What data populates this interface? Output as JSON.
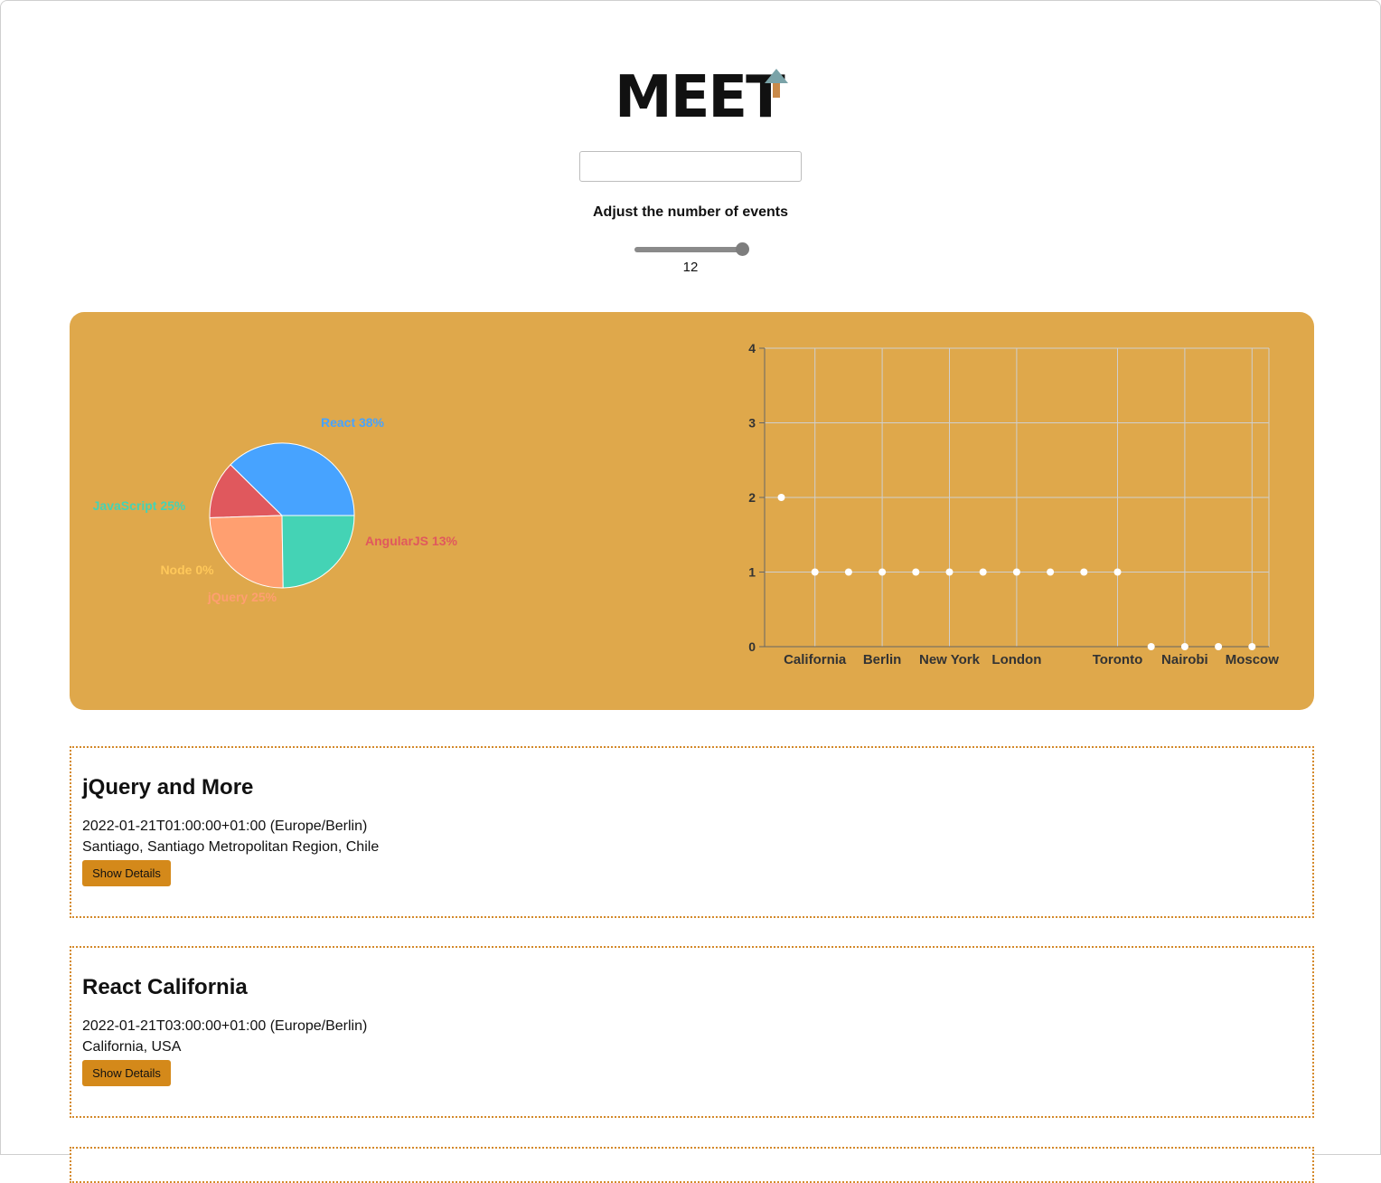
{
  "header": {
    "logo_text": "MEET",
    "logo_arrow_colors": [
      "#7aa3a8",
      "#c98a49"
    ]
  },
  "search": {
    "value": "",
    "placeholder": ""
  },
  "number_of_events": {
    "label": "Adjust the number of events",
    "value": "12",
    "slider_fraction": 1.0
  },
  "colors": {
    "accent_panel": "#dfa84b",
    "button": "#d4891a",
    "card_border": "#d4892a"
  },
  "chart_data": [
    {
      "type": "pie",
      "slices": [
        {
          "label": "React 38%",
          "value": 38,
          "color": "#47a3ff"
        },
        {
          "label": "AngularJS 13%",
          "value": 13,
          "color": "#e0585d"
        },
        {
          "label": "jQuery 25%",
          "value": 25,
          "color": "#ff9f70"
        },
        {
          "label": "Node 0%",
          "value": 0,
          "color": "#ffc85a"
        },
        {
          "label": "JavaScript 25%",
          "value": 25,
          "color": "#44d3b5"
        }
      ]
    },
    {
      "type": "scatter",
      "ylim": [
        0,
        4
      ],
      "yticks": [
        "0",
        "1",
        "2",
        "3",
        "4"
      ],
      "xlabels_shown": [
        "California",
        "Berlin",
        "New York",
        "London",
        "Toronto",
        "Nairobi",
        "Moscow"
      ],
      "grid": true,
      "point_color": "#ffffff",
      "points": [
        2,
        1,
        1,
        1,
        1,
        1,
        1,
        1,
        1,
        1,
        1,
        0,
        0,
        0,
        0
      ]
    }
  ],
  "events": [
    {
      "title": "jQuery and More",
      "start": "2022-01-21T01:00:00+01:00 (Europe/Berlin)",
      "location": "Santiago, Santiago Metropolitan Region, Chile",
      "button": "Show Details"
    },
    {
      "title": "React California",
      "start": "2022-01-21T03:00:00+01:00 (Europe/Berlin)",
      "location": "California, USA",
      "button": "Show Details"
    }
  ]
}
